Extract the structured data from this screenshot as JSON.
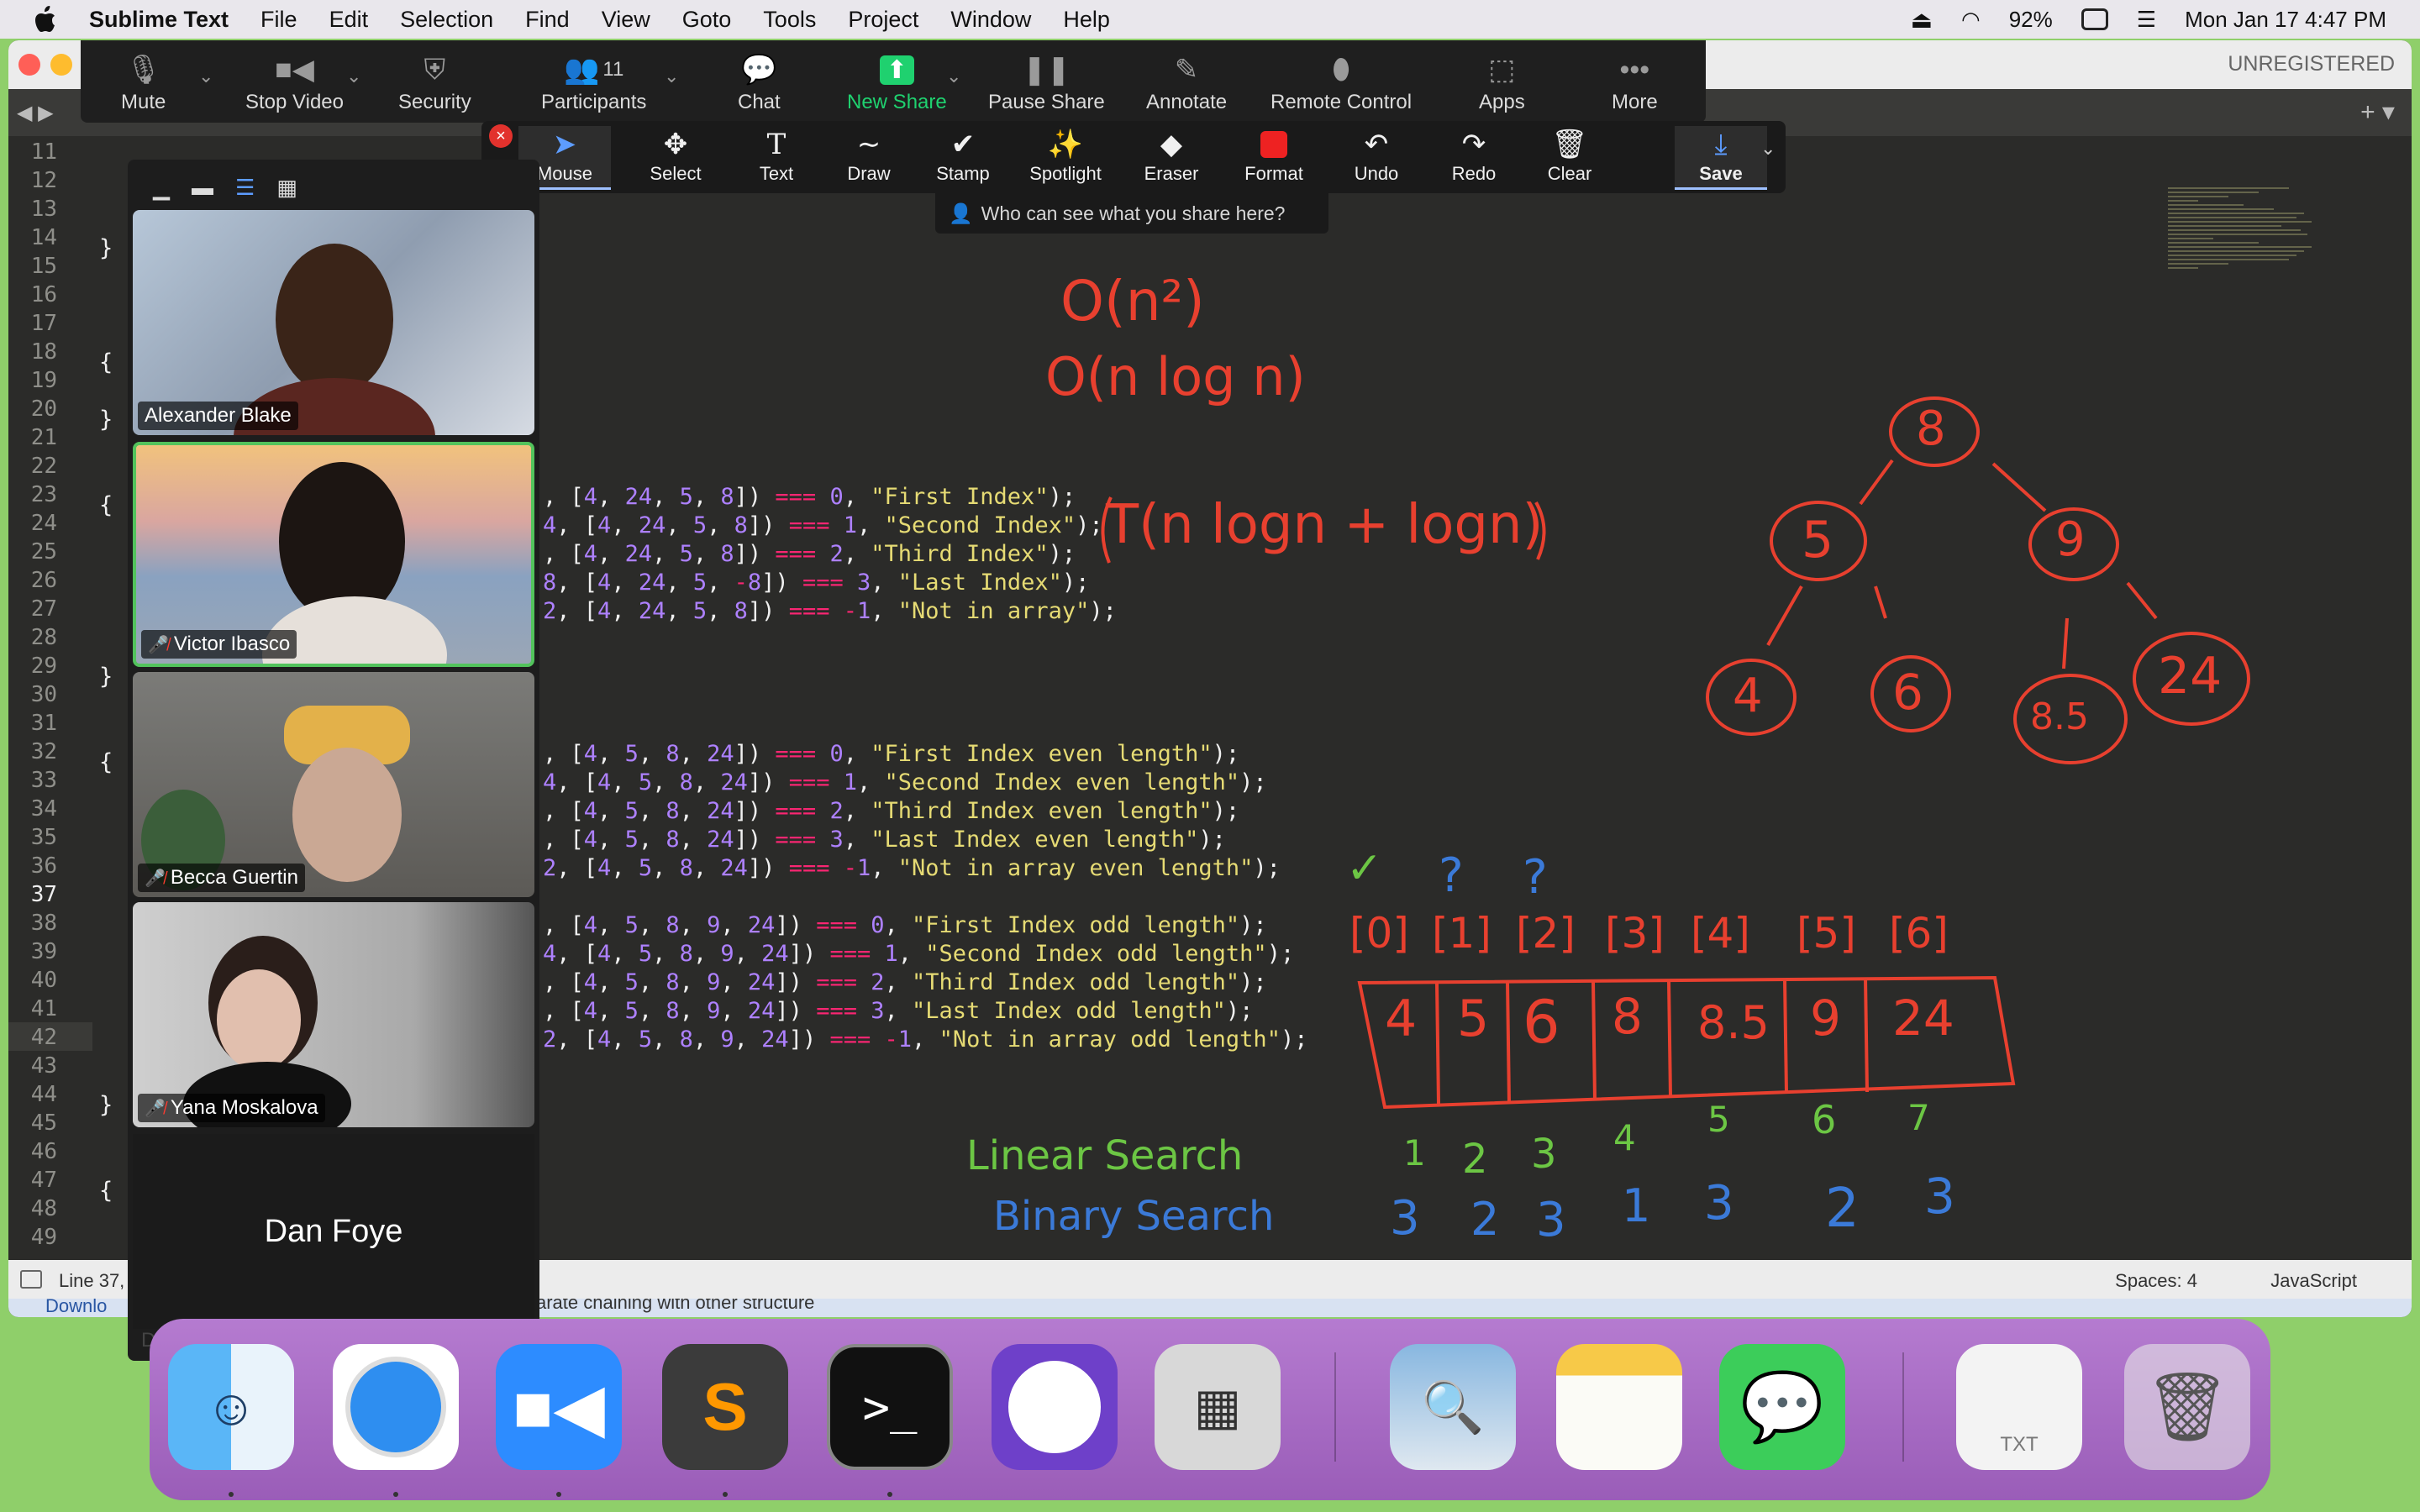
{
  "menubar": {
    "items": [
      "Sublime Text",
      "File",
      "Edit",
      "Selection",
      "Find",
      "View",
      "Goto",
      "Tools",
      "Project",
      "Window",
      "Help"
    ],
    "battery": "92%",
    "datetime": "Mon Jan 17  4:47 PM"
  },
  "sublime": {
    "unregistered": "UNREGISTERED",
    "status_left": "Line 37,",
    "spaces": "Spaces: 4",
    "language": "JavaScript",
    "download_text": "Downlo",
    "download_text2": "arate chaining with other structure",
    "line_numbers": [
      "11",
      "12",
      "13",
      "14",
      "15",
      "16",
      "17",
      "18",
      "19",
      "20",
      "21",
      "22",
      "23",
      "24",
      "25",
      "26",
      "27",
      "28",
      "29",
      "30",
      "31",
      "32",
      "33",
      "34",
      "35",
      "36",
      "37",
      "38",
      "39",
      "40",
      "41",
      "42",
      "43",
      "44",
      "45",
      "46",
      "47",
      "48",
      "49"
    ],
    "current_line": "37"
  },
  "zoom_toolbar": {
    "buttons": [
      "Mute",
      "Stop Video",
      "Security",
      "Participants",
      "Chat",
      "New Share",
      "Pause Share",
      "Annotate",
      "Remote Control",
      "Apps",
      "More"
    ],
    "participants_count": "11"
  },
  "annotation_toolbar": {
    "buttons": [
      "Mouse",
      "Select",
      "Text",
      "Draw",
      "Stamp",
      "Spotlight",
      "Eraser",
      "Format",
      "Undo",
      "Redo",
      "Clear",
      "Save"
    ],
    "who_can_see": "Who can see what you share here?"
  },
  "participants": [
    {
      "name": "Alexander Blake",
      "muted": false
    },
    {
      "name": "Victor Ibasco",
      "muted": true
    },
    {
      "name": "Becca Guertin",
      "muted": true
    },
    {
      "name": "Yana Moskalova",
      "muted": true
    },
    {
      "name": "Dan Foye",
      "muted": true
    }
  ],
  "annotations": {
    "big_o_1": "O(n²)",
    "big_o_2": "O(n log n)",
    "t_expr": "T(n logn  + logn)",
    "tree_nodes": [
      "8",
      "5",
      "9",
      "4",
      "6",
      "8.5",
      "24"
    ],
    "linear_search": "Linear Search",
    "binary_search": "Binary Search",
    "array_indices": [
      "[0]",
      "[1]",
      "[2]",
      "[3]",
      "[4]",
      "[5]",
      "[6]"
    ],
    "array_values": [
      "4",
      "5",
      "6",
      "8",
      "8.5",
      "9",
      "24"
    ],
    "linear_counts": [
      "1",
      "2",
      "3",
      "4",
      "5",
      "6",
      "7"
    ],
    "binary_counts": [
      "3",
      "2",
      "3",
      "1",
      "3",
      "2",
      "3"
    ],
    "marks": [
      "✓",
      "?",
      "?"
    ]
  },
  "dock": {
    "apps": [
      "finder-icon",
      "safari-icon",
      "zoom-icon",
      "sublime-icon",
      "terminal-icon",
      "github-icon",
      "calculator-icon",
      "preview-icon",
      "notes-icon",
      "messages-icon",
      "txt-file-icon",
      "trash-icon"
    ],
    "txt_label": "TXT"
  },
  "colors": {
    "ink_red": "#e8402f",
    "ink_blue": "#3b7ad8",
    "ink_green": "#6cc644",
    "zoom_green": "#1fd16f"
  }
}
